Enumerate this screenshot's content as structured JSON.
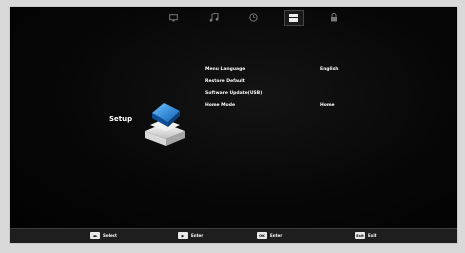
{
  "tabs": [
    {
      "name": "picture-icon"
    },
    {
      "name": "sound-icon"
    },
    {
      "name": "clock-icon"
    },
    {
      "name": "setup-icon",
      "active": true
    },
    {
      "name": "lock-icon"
    }
  ],
  "sidebar": {
    "title": "Setup"
  },
  "menu": {
    "items": [
      {
        "label": "Menu Language",
        "value": "English"
      },
      {
        "label": "Restore Default",
        "value": ""
      },
      {
        "label": "Software Update(USB)",
        "value": ""
      },
      {
        "label": "Home Mode",
        "value": "Home"
      }
    ]
  },
  "footer": {
    "hints": [
      {
        "key": "◄►",
        "label": "Select"
      },
      {
        "key": "▶",
        "label": "Enter"
      },
      {
        "key": "OK",
        "label": "Enter"
      },
      {
        "key": "Exit",
        "label": "Exit"
      }
    ]
  }
}
